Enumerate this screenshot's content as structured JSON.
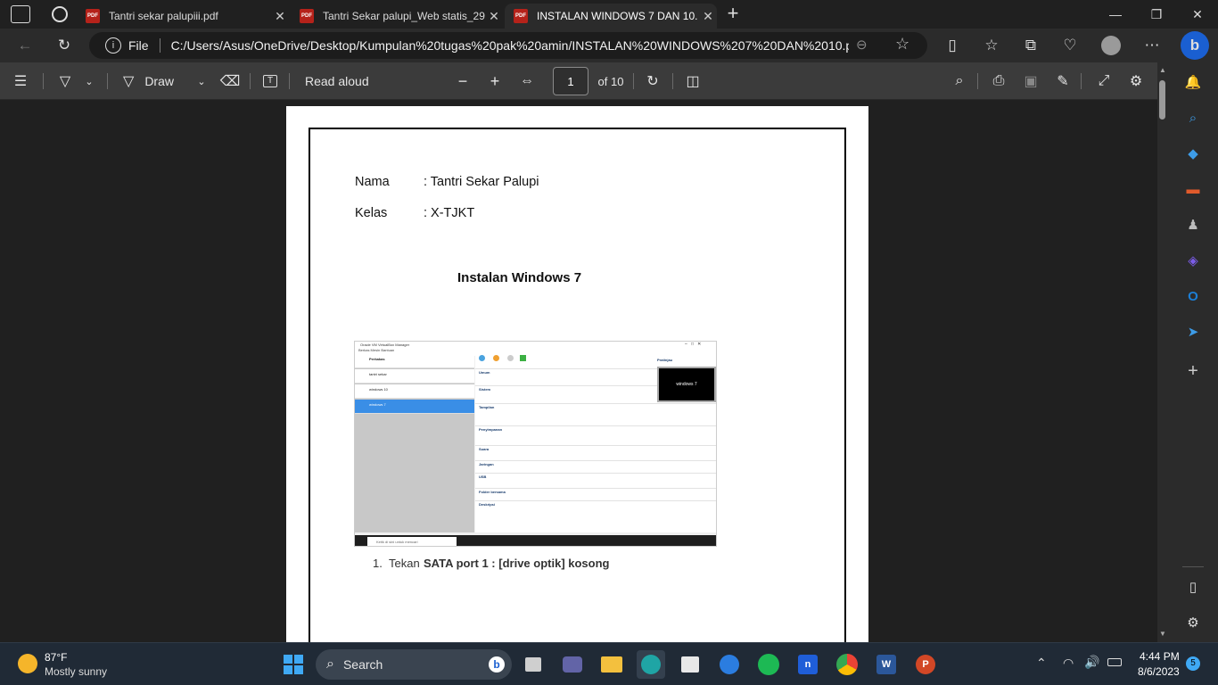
{
  "tabs": [
    {
      "title": "",
      "icon": "github-icon"
    },
    {
      "title": "Tantri sekar palupiii.pdf",
      "icon": "pdf-icon"
    },
    {
      "title": "Tantri Sekar palupi_Web statis_29",
      "icon": "pdf-icon"
    },
    {
      "title": "INSTALAN WINDOWS 7 DAN 10.",
      "icon": "pdf-icon"
    }
  ],
  "address": {
    "file_label": "File",
    "url": "C:/Users/Asus/OneDrive/Desktop/Kumpulan%20tugas%20pak%20amin/INSTALAN%20WINDOWS%207%20DAN%2010.pdf"
  },
  "pdf_toolbar": {
    "draw_label": "Draw",
    "read_aloud_label": "Read aloud",
    "page_current": "1",
    "page_total": "of 10"
  },
  "document": {
    "nama_label": "Nama",
    "nama_value": ": Tantri Sekar Palupi",
    "kelas_label": "Kelas",
    "kelas_value": ": X-TJKT",
    "heading": "Instalan Windows 7",
    "list_number": "1.",
    "list_text": "Tekan",
    "list_bold": "SATA port 1 : [drive optik] kosong"
  },
  "screenshot": {
    "window_title": "Oracle VM VirtualBox Manager",
    "menu": "Berkas  Mesin  Bantuan",
    "vms": [
      "Perkakas",
      "tantri sekar",
      "windows 10",
      "windows 7"
    ],
    "vm_state": "Dimatikan",
    "sections": [
      "Umum",
      "Sistem",
      "Tampilan",
      "Penyimpanan",
      "Suara",
      "Jaringan",
      "USB",
      "Folder bersama",
      "Deskripsi"
    ],
    "preview_label": "Pratinjau",
    "preview_text": "windows 7",
    "search_placeholder": "Ketik di sini untuk mencari"
  },
  "taskbar": {
    "weather_temp": "87°F",
    "weather_desc": "Mostly sunny",
    "search_label": "Search",
    "time": "4:44 PM",
    "date": "8/6/2023",
    "notif_count": "5"
  },
  "colors": {
    "accent": "#0a74da",
    "pdf_red": "#b5221a"
  }
}
